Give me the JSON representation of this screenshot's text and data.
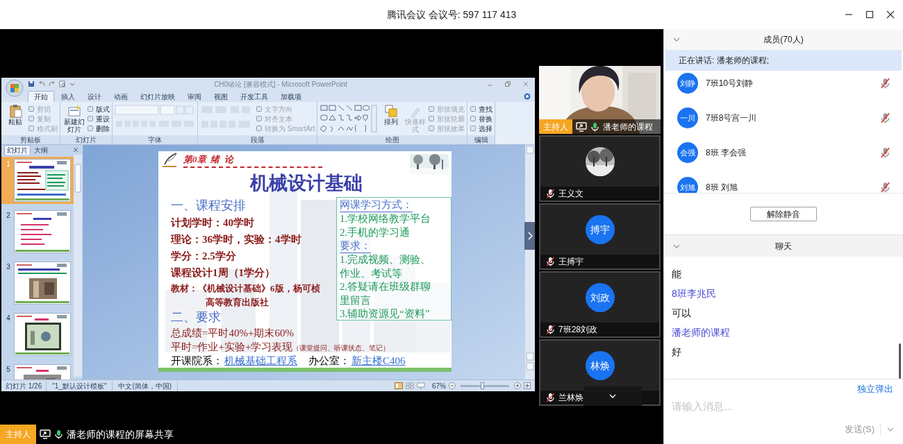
{
  "window": {
    "title": "腾讯会议 会议号: 597 117 413"
  },
  "shared_screen": {
    "app_title": "CH0绪论 [兼容模式] - Microsoft PowerPoint",
    "ribbon_tabs": [
      {
        "label": "开始",
        "selected": true
      },
      {
        "label": "插入",
        "selected": false
      },
      {
        "label": "设计",
        "selected": false
      },
      {
        "label": "动画",
        "selected": false
      },
      {
        "label": "幻灯片放映",
        "selected": false
      },
      {
        "label": "审阅",
        "selected": false
      },
      {
        "label": "视图",
        "selected": false
      },
      {
        "label": "开发工具",
        "selected": false
      },
      {
        "label": "加载项",
        "selected": false
      }
    ],
    "ribbon_groups": [
      {
        "label": "剪贴板",
        "items": [
          {
            "kind": "large",
            "label": "粘贴",
            "disabled": false
          },
          {
            "kind": "small",
            "label": "剪切",
            "disabled": true
          },
          {
            "kind": "small",
            "label": "复制",
            "disabled": true
          },
          {
            "kind": "small",
            "label": "格式刷",
            "disabled": true
          }
        ]
      },
      {
        "label": "幻灯片",
        "items": [
          {
            "kind": "large",
            "label": "新建幻灯片",
            "disabled": false
          },
          {
            "kind": "small",
            "label": "版式",
            "disabled": false
          },
          {
            "kind": "small",
            "label": "重设",
            "disabled": false
          },
          {
            "kind": "small",
            "label": "删除",
            "disabled": false
          }
        ]
      },
      {
        "label": "字体",
        "items": [
          {
            "kind": "font_controls",
            "disabled": true
          }
        ]
      },
      {
        "label": "段落",
        "items": [
          {
            "kind": "paragraph_controls",
            "disabled": true
          },
          {
            "kind": "small",
            "label": "文字方向",
            "disabled": true
          },
          {
            "kind": "small",
            "label": "对齐文本",
            "disabled": true
          },
          {
            "kind": "small",
            "label": "转换为 SmartArt",
            "disabled": true
          }
        ]
      },
      {
        "label": "绘图",
        "items": [
          {
            "kind": "shape_gallery",
            "disabled": false
          },
          {
            "kind": "large",
            "label": "排列",
            "disabled": false
          },
          {
            "kind": "large",
            "label": "快速样式",
            "disabled": true
          },
          {
            "kind": "small",
            "label": "形状填充",
            "disabled": true
          },
          {
            "kind": "small",
            "label": "形状轮廓",
            "disabled": true
          },
          {
            "kind": "small",
            "label": "形状效果",
            "disabled": true
          }
        ]
      },
      {
        "label": "编辑",
        "items": [
          {
            "kind": "small",
            "label": "查找",
            "disabled": false
          },
          {
            "kind": "small",
            "label": "替换",
            "disabled": false
          },
          {
            "kind": "small",
            "label": "选择",
            "disabled": false
          }
        ]
      }
    ],
    "pane_tabs": [
      {
        "label": "幻灯片",
        "selected": true
      },
      {
        "label": "大纲",
        "selected": false
      }
    ],
    "thumbnails": [
      {
        "number": "1",
        "selected": true
      },
      {
        "number": "2",
        "selected": false
      },
      {
        "number": "3",
        "selected": false
      },
      {
        "number": "4",
        "selected": false
      },
      {
        "number": "5",
        "selected": false
      }
    ],
    "slide": {
      "chapter": "第0章  绪  论",
      "title": "机械设计基础",
      "left": [
        {
          "kind": "heading",
          "text": "一、课程安排"
        },
        {
          "kind": "line",
          "text": "计划学时：40学时"
        },
        {
          "kind": "line",
          "text": "理论：36学时，实验：4学时"
        },
        {
          "kind": "line",
          "text": "学分：2.5学分"
        },
        {
          "kind": "line",
          "text": "课程设计1周（1学分）"
        },
        {
          "kind": "small",
          "text": "教材：《机械设计基础》6版，杨可桢"
        },
        {
          "kind": "indent",
          "text": "高等教育出版社"
        },
        {
          "kind": "heading",
          "text": "二、要求"
        }
      ],
      "right": [
        {
          "kind": "heading",
          "text": "网课学习方式："
        },
        {
          "kind": "line",
          "text": "1.学校网络教学平台"
        },
        {
          "kind": "line",
          "text": "2.手机的学习通"
        },
        {
          "kind": "heading",
          "text": "要求："
        },
        {
          "kind": "line",
          "text": "1.完成视频、测验、"
        },
        {
          "kind": "line",
          "text": "作业、考试等"
        },
        {
          "kind": "line",
          "text": "2.答疑请在班级群聊"
        },
        {
          "kind": "line",
          "text": "里留言"
        },
        {
          "kind": "line",
          "text": "3.辅助资源见“资料”"
        }
      ],
      "bottom": [
        {
          "text": "总成绩=平时40%+期末60%"
        },
        {
          "text": "平时=作业+实验+学习表现",
          "note": "（课堂提问、听课状态、笔记）"
        }
      ],
      "footer": [
        {
          "kind": "label",
          "text": "开课院系："
        },
        {
          "kind": "link",
          "text": "机械基础工程系"
        },
        {
          "kind": "label",
          "text": "办公室："
        },
        {
          "kind": "link",
          "text": "新主楼C406"
        }
      ]
    },
    "status_bar": {
      "slide": "幻灯片 1/26",
      "template": "\"1_默认设计模板\"",
      "language": "中文(简体，中国)",
      "zoom": "67%",
      "zoom_slider": {
        "level": 0.45
      }
    }
  },
  "video_tiles": [
    {
      "kind": "video",
      "name": "潘老师的课程",
      "role": "主持人",
      "sharing": true,
      "muted": false
    },
    {
      "name": "王义文",
      "sharing": false,
      "muted": true
    },
    {
      "kind": "avatar",
      "avatar": "搏宇",
      "name": "王搏宇",
      "sharing": false,
      "muted": true
    },
    {
      "kind": "avatar",
      "avatar": "刘政",
      "name": "7班28刘政",
      "sharing": false,
      "muted": true
    },
    {
      "kind": "avatar",
      "avatar": "林焕",
      "name": "兰林焕",
      "sharing": false,
      "muted": true
    }
  ],
  "presenter_bar": {
    "role": "主持人",
    "text": "潘老师的课程的屏幕共享"
  },
  "members": {
    "title": "成员(70人)",
    "speaking": "正在讲话: 潘老师的课程;",
    "list": [
      {
        "avatar": "刘静",
        "name": "7班10号刘静",
        "muted": true
      },
      {
        "avatar": "一川",
        "name": "7班8号宫一川",
        "muted": true
      },
      {
        "avatar": "会强",
        "name": "8班 李会强",
        "muted": true
      },
      {
        "avatar": "刘旭",
        "name": "8班 刘旭",
        "muted": true
      }
    ],
    "unmute_button": "解除静音"
  },
  "chat": {
    "title": "聊天",
    "messages": [
      {
        "kind": "text",
        "text": "能"
      },
      {
        "kind": "sender",
        "text": "8班李兆民"
      },
      {
        "kind": "text",
        "text": "可以"
      },
      {
        "kind": "sender",
        "text": "潘老师的课程"
      },
      {
        "kind": "text",
        "text": "好"
      }
    ],
    "popout": "独立弹出",
    "placeholder": "请输入消息...",
    "send": "发送(S)"
  }
}
